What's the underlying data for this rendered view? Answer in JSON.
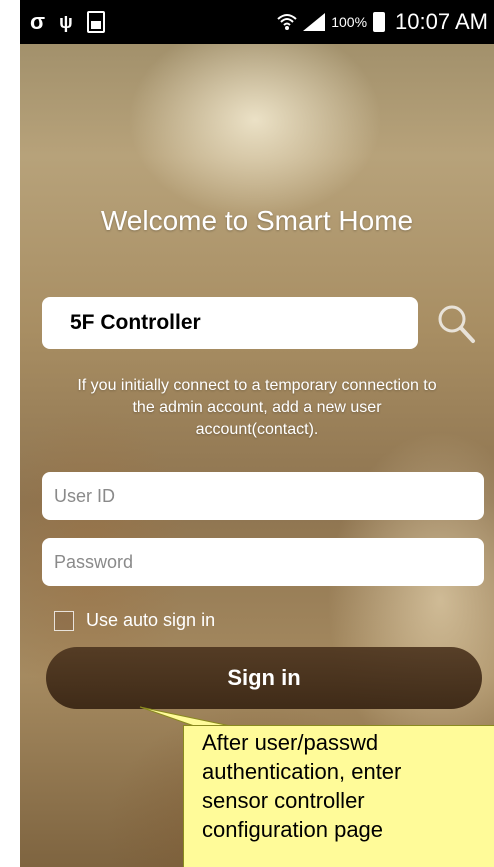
{
  "status_bar": {
    "left_icons": [
      "carrier-icon",
      "usb-icon",
      "battery-saver-icon"
    ],
    "battery_percent": "100%",
    "time": "10:07 AM"
  },
  "login": {
    "welcome": "Welcome to Smart Home",
    "controller_name": "5F Controller",
    "info_lines": [
      "If you initially connect to a temporary connection to",
      "the admin account, add a new user",
      "account(contact)."
    ],
    "user_id_placeholder": "User ID",
    "password_placeholder": "Password",
    "auto_sign_in_label": "Use auto sign in",
    "sign_in_label": "Sign in"
  },
  "annotation": {
    "lines": [
      "After user/passwd",
      "authentication, enter",
      "sensor controller",
      "configuration page"
    ]
  },
  "colors": {
    "callout_bg": "#fffb99",
    "button_bg": "#4e3620",
    "status_bar_bg": "#000000"
  }
}
